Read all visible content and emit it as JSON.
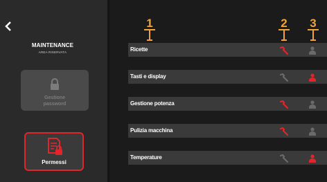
{
  "sidebar": {
    "back_icon": "chevron-left-icon",
    "title": "MAINTENANCE",
    "subtitle": "AREA RISERVATA",
    "password_tile": {
      "label_line1": "Gestione",
      "label_line2": "password",
      "icon": "lock-icon"
    },
    "permessi_tile": {
      "label": "Permessi",
      "icon": "document-lock-icon"
    }
  },
  "rows": [
    {
      "label": "Ricette",
      "wrench": "active",
      "person": "inactive"
    },
    {
      "label": "Tasti e display",
      "wrench": "inactive",
      "person": "active"
    },
    {
      "label": "Gestione potenza",
      "wrench": "active",
      "person": "inactive"
    },
    {
      "label": "Pulizia macchina",
      "wrench": "active",
      "person": "inactive"
    },
    {
      "label": "Temperature",
      "wrench": "inactive",
      "person": "active"
    }
  ],
  "callouts": [
    "1",
    "2",
    "3"
  ],
  "colors": {
    "active": "#e0262b",
    "inactive": "#6a6a6a",
    "callout": "#f2a43a"
  }
}
